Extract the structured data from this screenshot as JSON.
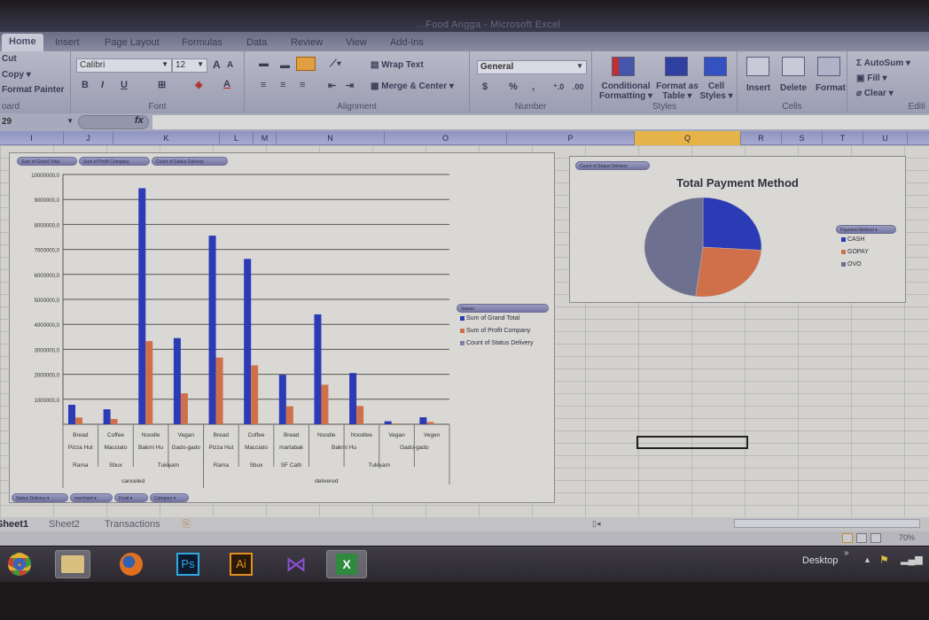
{
  "window": {
    "title": "...Food Angga - Microsoft Excel"
  },
  "ribbon_tabs": [
    "Home",
    "Insert",
    "Page Layout",
    "Formulas",
    "Data",
    "Review",
    "View",
    "Add-Ins"
  ],
  "clipboard": {
    "cut": "Cut",
    "copy": "Copy ▾",
    "format_painter": "Format Painter",
    "label": "oard"
  },
  "font": {
    "name": "Calibri",
    "size": "12",
    "label": "Font",
    "bold": "B",
    "italic": "I",
    "underline": "U",
    "grow": "A",
    "shrink": "A"
  },
  "alignment": {
    "wrap_text": "Wrap Text",
    "merge_center": "Merge & Center ▾",
    "label": "Alignment"
  },
  "number": {
    "format": "General",
    "currency": "$",
    "percent": "%",
    "comma": ",",
    "inc_decimal": "⁺.0",
    "dec_decimal": ".00",
    "label": "Number"
  },
  "styles": {
    "conditional": "Conditional Formatting ▾",
    "format_table": "Format as Table ▾",
    "cell_styles": "Cell Styles ▾",
    "label": "Styles"
  },
  "cells": {
    "insert": "Insert",
    "delete": "Delete",
    "format": "Format",
    "label": "Cells"
  },
  "editing": {
    "autosum": "Σ AutoSum ▾",
    "fill": "Fill ▾",
    "clear": "Clear ▾",
    "label": "Editi"
  },
  "formula_bar": {
    "name_box": "29",
    "fx": "fx",
    "value": ""
  },
  "columns": [
    "I",
    "J",
    "K",
    "L",
    "M",
    "N",
    "O",
    "P",
    "Q",
    "R",
    "S",
    "T",
    "U"
  ],
  "selected_column": "Q",
  "pivot_chart": {
    "value_buttons": [
      "Sum of Grand Total",
      "Sum of Profit Company",
      "Count of Status Delivery"
    ],
    "axis_buttons": [
      "Status Delivery",
      "merchant",
      "Food",
      "Category"
    ],
    "legend_title": "Values"
  },
  "pie_chart": {
    "value_button": "Count of Status Delivery",
    "legend_button": "Payment Method"
  },
  "chart_data": [
    {
      "type": "bar",
      "title": "",
      "xlabel": "",
      "ylabel": "",
      "ylim": [
        0,
        10000000
      ],
      "yticks": [
        "1000000,0",
        "2000000,0",
        "3000000,0",
        "4000000,0",
        "5000000,0",
        "6000000,0",
        "7000000,0",
        "8000000,0",
        "9000000,0",
        "10000000,0"
      ],
      "grid": true,
      "legend": "right",
      "categories": [
        {
          "category": "Bread",
          "food": "Pizza Hut",
          "merchant": "Rama",
          "status": "canceled"
        },
        {
          "category": "Coffee",
          "food": "Macciato",
          "merchant": "Sbux",
          "status": "canceled"
        },
        {
          "category": "Noodle",
          "food": "Bakmi Hu",
          "merchant": "Tukiyam",
          "status": "canceled"
        },
        {
          "category": "Vegan",
          "food": "Gado-gado",
          "merchant": "Tukiyam",
          "status": "canceled"
        },
        {
          "category": "Bread",
          "food": "Pizza Hut",
          "merchant": "Rama",
          "status": "delivered"
        },
        {
          "category": "Coffee",
          "food": "Macciato",
          "merchant": "Sbux",
          "status": "delivered"
        },
        {
          "category": "Bread",
          "food": "martabak",
          "merchant": "SF Cath",
          "status": "delivered"
        },
        {
          "category": "Noodle",
          "food": "Bakmi Hu",
          "merchant": "Tukiyam",
          "status": "delivered"
        },
        {
          "category": "Noodlee",
          "food": "Bakmi Hu",
          "merchant": "Tukiyam",
          "status": "delivered"
        },
        {
          "category": "Vegan",
          "food": "Gado-gado",
          "merchant": "Tukiyam",
          "status": "delivered"
        },
        {
          "category": "Vegen",
          "food": "Gado-gado",
          "merchant": "Tukiyam",
          "status": "delivered"
        }
      ],
      "level_groups": {
        "food": [
          {
            "label": "Pizza Hut",
            "span": 1
          },
          {
            "label": "Macciato",
            "span": 1
          },
          {
            "label": "Bakmi Hu",
            "span": 1
          },
          {
            "label": "Gado-gado",
            "span": 1
          },
          {
            "label": "Pizza Hut",
            "span": 1
          },
          {
            "label": "Macciato",
            "span": 1
          },
          {
            "label": "martabak",
            "span": 1
          },
          {
            "label": "Bakmi Hu",
            "span": 2
          },
          {
            "label": "Gado-gado",
            "span": 2
          }
        ],
        "merchant": [
          {
            "label": "Rama",
            "span": 1
          },
          {
            "label": "Sbux",
            "span": 1
          },
          {
            "label": "Tukiyam",
            "span": 2
          },
          {
            "label": "Rama",
            "span": 1
          },
          {
            "label": "Sbux",
            "span": 1
          },
          {
            "label": "SF Cath",
            "span": 1
          },
          {
            "label": "Tukiyam",
            "span": 4
          }
        ],
        "status": [
          {
            "label": "canceled",
            "span": 4
          },
          {
            "label": "delivered",
            "span": 7
          }
        ]
      },
      "series": [
        {
          "name": "Sum of Grand Total",
          "color": "#2b3ab5",
          "values": [
            780000,
            600000,
            9450000,
            3450000,
            7550000,
            6620000,
            1980000,
            4400000,
            2050000,
            120000,
            280000
          ]
        },
        {
          "name": "Sum of Profit Company",
          "color": "#d0704a",
          "values": [
            270000,
            210000,
            3330000,
            1240000,
            2670000,
            2360000,
            720000,
            1580000,
            730000,
            30000,
            90000
          ]
        },
        {
          "name": "Count of Status Delivery",
          "color": "#7d7fa8",
          "values": [
            1,
            1,
            1,
            1,
            1,
            1,
            1,
            1,
            1,
            1,
            1
          ]
        }
      ]
    },
    {
      "type": "pie",
      "title": "Total Payment Method",
      "legend": "right",
      "labels": [
        "CASH",
        "GOPAY",
        "OVO"
      ],
      "colors": [
        "#2b3ab5",
        "#d0704a",
        "#6e708f"
      ],
      "values": [
        26,
        26,
        48
      ]
    }
  ],
  "sheet_tabs": [
    "Sheet1",
    "Sheet2",
    "Transactions"
  ],
  "active_sheet": "Sheet1",
  "status": {
    "zoom": "70%"
  },
  "taskbar": {
    "apps": [
      "Chrome",
      "File Explorer",
      "Firefox",
      "Ps",
      "Ai",
      "Visual Studio",
      "Excel"
    ],
    "desktop_label": "Desktop",
    "overflow": "»"
  }
}
